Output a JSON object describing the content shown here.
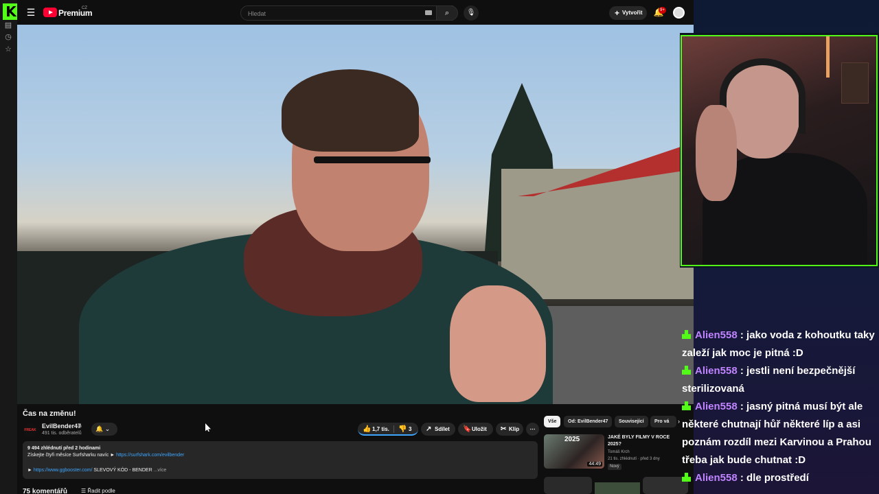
{
  "kick": {
    "logo": "K"
  },
  "topbar": {
    "brand": "Premium",
    "country": "CZ",
    "search_placeholder": "Hledat",
    "create_label": "Vytvořit",
    "notif_count": "9+"
  },
  "video": {
    "title": "Čas na změnu!",
    "channel": {
      "avatar_text": "FREAK",
      "name": "EvilBender47",
      "subscribers": "491 tis. odběratelů"
    },
    "likes": "1,7 tis.",
    "dislikes": "3",
    "share_label": "Sdílet",
    "save_label": "Uložit",
    "clip_label": "Klip",
    "more_label": "⋯",
    "description": {
      "stats": "9 494 zhlédnutí  před 2 hodinami",
      "line2_text": "Získejte čtyři měsíce Surfsharku navíc ► ",
      "line2_link": "https://surfshark.com/evilbender",
      "line3_prefix": "► ",
      "line3_link": "https://www.ggbooster.com/",
      "line3_text": " SLEVOVÝ KÓD - BENDER",
      "more": " ...více"
    },
    "comments_count": "75 komentářů",
    "sort_label": "Řadit podle"
  },
  "chips": [
    "Vše",
    "Od: EvilBender47",
    "Související",
    "Pro vá"
  ],
  "related": [
    {
      "thumb_text": "2025",
      "duration": "44:49",
      "title": "JAKÉ BYLY FILMY V ROCE 2025?",
      "channel": "Tomáš Krch",
      "meta": "21 tis. zhlédnutí · před 3 dny",
      "badge": "Nový"
    }
  ],
  "chat": [
    {
      "user": "Alien558",
      "text": " : jako voda z kohoutku taky zaleží jak moc je pitná :D"
    },
    {
      "user": "Alien558",
      "text": " : jestli není bezpečnější sterilizovaná"
    },
    {
      "user": "Alien558",
      "text": " : jasný pitná musí být ale některé chutnají hůř některé líp a asi poznám rozdíl mezi Karvinou a Prahou třeba jak bude chutnat :D"
    },
    {
      "user": "Alien558",
      "text": " : dle prostředí"
    }
  ],
  "colors": {
    "kick_green": "#53fc18",
    "yt_red": "#ff0033",
    "chat_user": "#c084ff",
    "link_blue": "#3ea6ff"
  },
  "icons": {
    "menu": "hamburger-icon",
    "search": "search-icon",
    "mic": "mic-icon",
    "bell": "bell-icon",
    "like": "thumbs-up-icon",
    "dislike": "thumbs-down-icon",
    "share": "share-icon",
    "save": "bookmark-icon",
    "clip": "scissors-icon"
  }
}
